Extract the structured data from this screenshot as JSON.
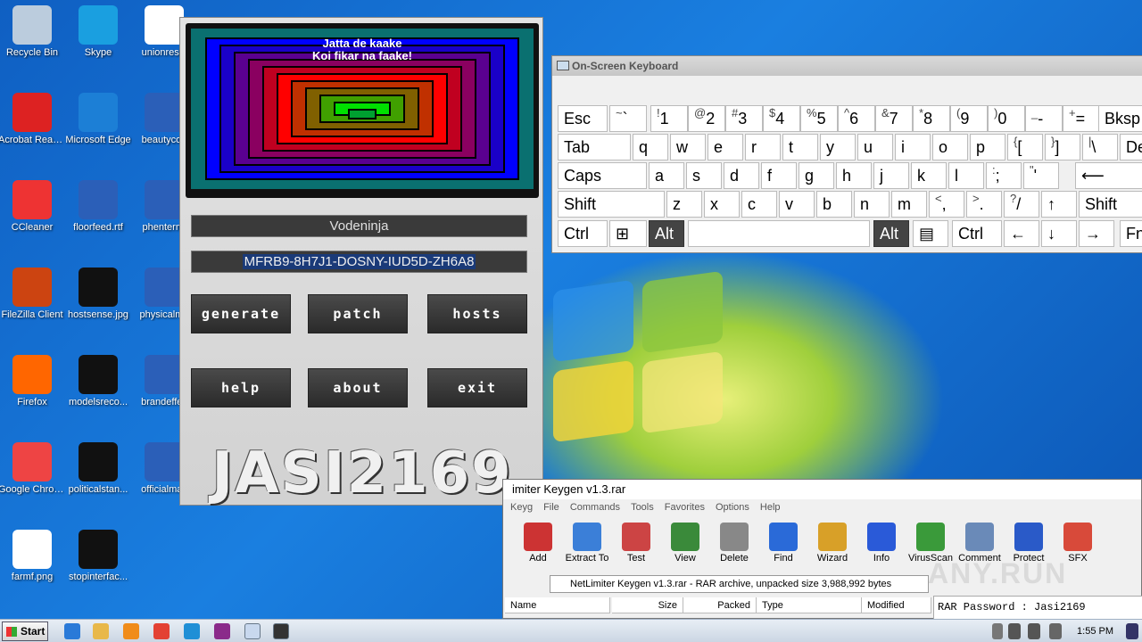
{
  "desktop": {
    "icons": [
      {
        "label": "Recycle Bin"
      },
      {
        "label": "Skype"
      },
      {
        "label": "unionresol"
      },
      {
        "label": "Acrobat Reader DC"
      },
      {
        "label": "Microsoft Edge"
      },
      {
        "label": "beautycoa"
      },
      {
        "label": "CCleaner"
      },
      {
        "label": "floorfeed.rtf"
      },
      {
        "label": "phentermi"
      },
      {
        "label": "FileZilla Client"
      },
      {
        "label": "hostsense.jpg"
      },
      {
        "label": "physicalma"
      },
      {
        "label": "Firefox"
      },
      {
        "label": "modelsreco..."
      },
      {
        "label": "brandeffec"
      },
      {
        "label": "Google Chrome"
      },
      {
        "label": "politicalstan..."
      },
      {
        "label": "officialmay"
      },
      {
        "label": "farmf.png"
      },
      {
        "label": "stopinterfac..."
      }
    ]
  },
  "keygen": {
    "banner_line1": "Jatta de kaake",
    "banner_line2": "Koi fikar na faake!",
    "product_name": "Vodeninja",
    "serial": "MFRB9-8H7J1-DOSNY-IUD5D-ZH6A8",
    "buttons": {
      "generate": "Generate",
      "patch": "Patch",
      "hosts": "Hosts",
      "help": "Help",
      "about": "About",
      "exit": "Exit"
    },
    "logo_text": "JASI2169"
  },
  "osk": {
    "title": "On-Screen Keyboard",
    "row1": [
      {
        "main": "Esc"
      },
      {
        "sup": "~",
        "main": "`"
      },
      {
        "sup": "!",
        "main": "1"
      },
      {
        "sup": "@",
        "main": "2"
      },
      {
        "sup": "#",
        "main": "3"
      },
      {
        "sup": "$",
        "main": "4"
      },
      {
        "sup": "%",
        "main": "5"
      },
      {
        "sup": "^",
        "main": "6"
      },
      {
        "sup": "&",
        "main": "7"
      },
      {
        "sup": "*",
        "main": "8"
      },
      {
        "sup": "(",
        "main": "9"
      },
      {
        "sup": ")",
        "main": "0"
      },
      {
        "sup": "_",
        "main": "-"
      },
      {
        "sup": "+",
        "main": "="
      },
      {
        "main": "Bksp"
      }
    ],
    "row2": [
      {
        "main": "Tab"
      },
      {
        "main": "q"
      },
      {
        "main": "w"
      },
      {
        "main": "e"
      },
      {
        "main": "r"
      },
      {
        "main": "t"
      },
      {
        "main": "y"
      },
      {
        "main": "u"
      },
      {
        "main": "i"
      },
      {
        "main": "o"
      },
      {
        "main": "p"
      },
      {
        "sup": "{",
        "main": "["
      },
      {
        "sup": "}",
        "main": "]"
      },
      {
        "sup": "|",
        "main": "\\"
      },
      {
        "main": "Del"
      }
    ],
    "row3": [
      {
        "main": "Caps"
      },
      {
        "main": "a"
      },
      {
        "main": "s"
      },
      {
        "main": "d"
      },
      {
        "main": "f"
      },
      {
        "main": "g"
      },
      {
        "main": "h"
      },
      {
        "main": "j"
      },
      {
        "main": "k"
      },
      {
        "main": "l"
      },
      {
        "sup": ":",
        "main": ";"
      },
      {
        "sup": "\"",
        "main": "'"
      },
      {
        "main": "⟵"
      }
    ],
    "row4": [
      {
        "main": "Shift"
      },
      {
        "main": "z"
      },
      {
        "main": "x"
      },
      {
        "main": "c"
      },
      {
        "main": "v"
      },
      {
        "main": "b"
      },
      {
        "main": "n"
      },
      {
        "main": "m"
      },
      {
        "sup": "<",
        "main": ","
      },
      {
        "sup": ">",
        "main": "."
      },
      {
        "sup": "?",
        "main": "/"
      },
      {
        "main": "↑"
      },
      {
        "main": "Shift"
      }
    ],
    "row5": [
      {
        "main": "Ctrl"
      },
      {
        "main": "⊞"
      },
      {
        "main": "Alt"
      },
      {
        "main": ""
      },
      {
        "main": "Alt"
      },
      {
        "main": "▤"
      },
      {
        "main": "Ctrl"
      },
      {
        "main": "←"
      },
      {
        "main": "↓"
      },
      {
        "main": "→"
      },
      {
        "main": "Fn"
      }
    ]
  },
  "winrar": {
    "title": "imiter Keygen v1.3.rar",
    "menu": [
      "Keyg",
      "File",
      "Commands",
      "Tools",
      "Favorites",
      "Options",
      "Help"
    ],
    "toolbar": [
      "Add",
      "Extract To",
      "Test",
      "View",
      "Delete",
      "Find",
      "Wizard",
      "Info",
      "VirusScan",
      "Comment",
      "Protect",
      "SFX"
    ],
    "path": "NetLimiter Keygen v1.3.rar - RAR archive, unpacked size 3,988,992 bytes",
    "columns": [
      "Name",
      "Size",
      "Packed",
      "Type",
      "Modified"
    ],
    "comment": "RAR Password : Jasi2169"
  },
  "taskbar": {
    "start_label": "Start",
    "clock": "1:55 PM"
  },
  "watermark": "ANY.RUN"
}
